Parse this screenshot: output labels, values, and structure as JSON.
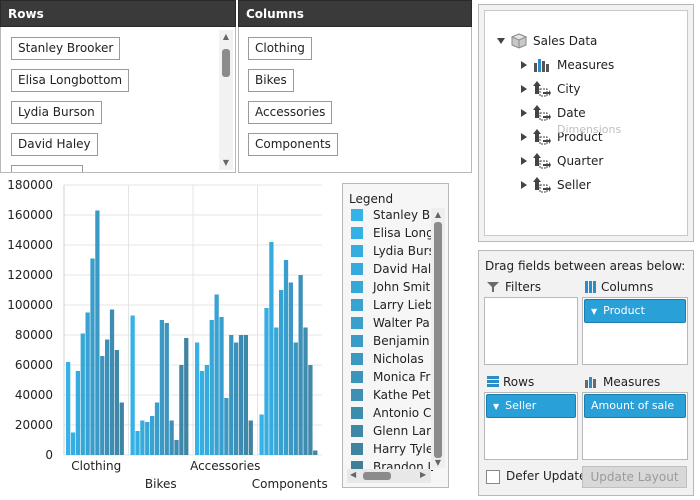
{
  "rows_panel": {
    "title": "Rows",
    "items": [
      "Stanley Brooker",
      "Elisa Longbottom",
      "Lydia Burson",
      "David Haley"
    ]
  },
  "columns_panel": {
    "title": "Columns",
    "items": [
      "Clothing",
      "Bikes",
      "Accessories",
      "Components"
    ]
  },
  "legend": {
    "title": "Legend",
    "items": [
      "Stanley Br",
      "Elisa Long",
      "Lydia Burs",
      "David Hal",
      "John Smit",
      "Larry Lieb",
      "Walter Pa",
      "Benjamin",
      "Nicholas",
      "Monica Fr",
      "Kathe Pet",
      "Antonio C",
      "Glenn Lar",
      "Harry Tyle",
      "Brandon L"
    ],
    "colors": [
      "#35b3e8",
      "#35b0e4",
      "#36ade0",
      "#36aadb",
      "#37a7d6",
      "#38a3d0",
      "#39a0cb",
      "#3a9cc5",
      "#3b98bf",
      "#3c94b9",
      "#3d90b2",
      "#3e8cac",
      "#3f87a5",
      "#40839e",
      "#417f98"
    ]
  },
  "tree": {
    "root": "Sales Data",
    "items": [
      "Measures",
      "City",
      "Date",
      "Product",
      "Quarter",
      "Seller"
    ],
    "overlay_label": "Dimensions"
  },
  "fields": {
    "instruction": "Drag fields between areas below:",
    "filters_label": "Filters",
    "columns_label": "Columns",
    "rows_label": "Rows",
    "measures_label": "Measures",
    "columns_chip": "Product",
    "rows_chip": "Seller",
    "measures_chip": "Amount of sale",
    "defer_label": "Defer Update",
    "update_button": "Update Layout"
  },
  "chart_data": {
    "type": "bar",
    "categories": [
      "Clothing",
      "Bikes",
      "Accessories",
      "Components"
    ],
    "ylim": [
      0,
      180000
    ],
    "yticks": [
      "0",
      "20000",
      "40000",
      "60000",
      "80000",
      "100000",
      "120000",
      "140000",
      "160000",
      "180000"
    ],
    "series_values": [
      [
        62000,
        15000,
        56000,
        81000,
        95000,
        131000,
        163000,
        66000,
        77000,
        97000,
        70000,
        35000
      ],
      [
        93000,
        16000,
        23000,
        22000,
        26000,
        35000,
        90000,
        88000,
        23000,
        10000,
        60000,
        78000
      ],
      [
        75000,
        56000,
        60000,
        90000,
        107000,
        92000,
        38000,
        80000,
        75000,
        80000,
        80000,
        23000
      ],
      [
        27000,
        98000,
        142000,
        85000,
        110000,
        130000,
        115000,
        75000,
        120000,
        85000,
        60000,
        3000
      ]
    ],
    "colors": [
      "#35b3e8",
      "#35afe3",
      "#36abde",
      "#37a7d8",
      "#38a2d2",
      "#399ecc",
      "#3b9ac5",
      "#3c95bf",
      "#3d91b8",
      "#3e8cb1",
      "#3f88aa",
      "#4184a2"
    ]
  }
}
